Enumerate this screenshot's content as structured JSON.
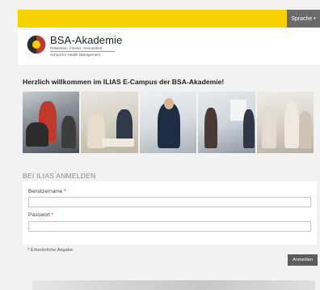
{
  "topbar": {
    "language_label": "Sprache",
    "language_caret": "▾"
  },
  "header": {
    "brand": "BSA-Akademie",
    "tagline": "Prävention, Fitness, Gesundheit",
    "school": "School for Health Management"
  },
  "main": {
    "welcome": "Herzlich willkommen im ILIAS E-Campus der BSA-Akademie!",
    "login_heading": "BEI ILIAS ANMELDEN",
    "username_label": "Benutzername",
    "password_label": "Passwort",
    "required_marker": "*",
    "required_note": "Erforderliche Angabe",
    "login_button": "Anmelden"
  },
  "colors": {
    "accent_yellow": "#f7d200",
    "button_gray": "#5c5c5c",
    "required_red": "#cc0000"
  }
}
